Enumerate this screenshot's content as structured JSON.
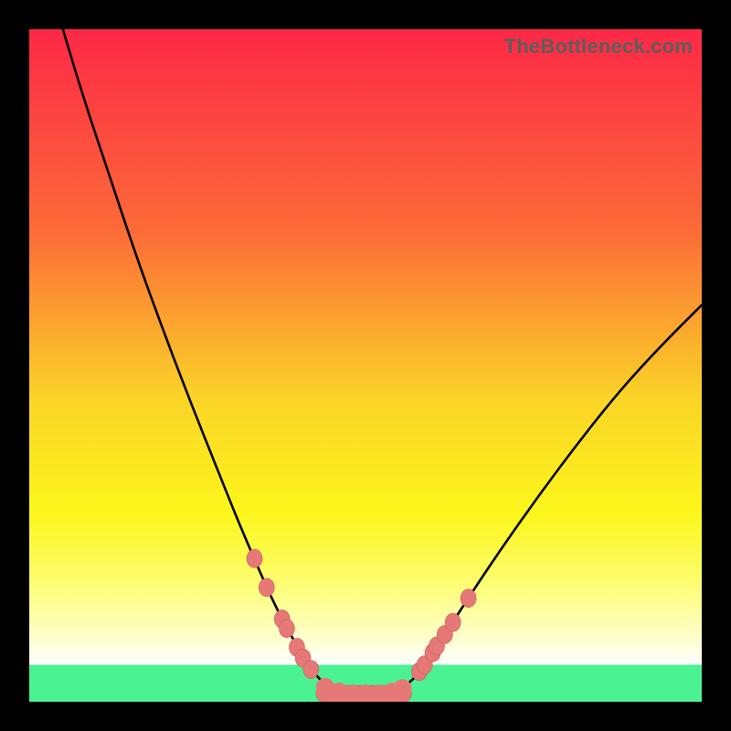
{
  "watermark": "TheBottleneck.com",
  "colors": {
    "frame": "#000000",
    "curve": "#000000",
    "marker_fill": "#e77878",
    "marker_stroke": "#c95c5c",
    "green_band": "#4af291",
    "gradient_stops": [
      {
        "offset": 0.0,
        "color": "#fd2846"
      },
      {
        "offset": 0.3,
        "color": "#fc6b38"
      },
      {
        "offset": 0.55,
        "color": "#fbd427"
      },
      {
        "offset": 0.72,
        "color": "#fcf61b"
      },
      {
        "offset": 0.82,
        "color": "#fdfd6e"
      },
      {
        "offset": 0.9,
        "color": "#feffc6"
      },
      {
        "offset": 0.945,
        "color": "#ffffff"
      }
    ]
  },
  "chart_data": {
    "type": "line",
    "title": "",
    "xlabel": "",
    "ylabel": "",
    "xlim": [
      0,
      100
    ],
    "ylim": [
      0,
      100
    ],
    "curve": {
      "x": [
        5,
        8,
        12,
        16,
        20,
        24,
        28,
        31,
        34,
        36,
        38,
        40,
        41.5,
        43,
        45,
        50,
        55,
        57,
        58.5,
        60,
        62,
        65,
        70,
        76,
        82,
        88,
        94,
        100
      ],
      "y": [
        100,
        90,
        78,
        66,
        55,
        44.5,
        34.5,
        27,
        20,
        15.5,
        11.5,
        8,
        5.5,
        3.5,
        1.8,
        1.2,
        1.8,
        3.2,
        5,
        7.3,
        10.3,
        15,
        22.5,
        31,
        39,
        46.5,
        53,
        59
      ]
    },
    "flat_band": {
      "y_from": 0,
      "y_to": 5.5
    },
    "markers_left": {
      "x": [
        33.5,
        35.3,
        37.6,
        38.3,
        39.8,
        40.7,
        41.9
      ],
      "y": [
        21.3,
        17.0,
        12.3,
        10.9,
        8.1,
        6.5,
        4.8
      ]
    },
    "markers_right": {
      "x": [
        58.0,
        58.8,
        60.0,
        60.6,
        61.8,
        63.0,
        65.3
      ],
      "y": [
        4.5,
        5.5,
        7.3,
        8.3,
        10.0,
        11.8,
        15.4
      ]
    },
    "trough_cluster": {
      "x": [
        44.0,
        46.0,
        48.0,
        50.0,
        52.0,
        54.0,
        55.5
      ],
      "y": [
        2.2,
        1.5,
        1.2,
        1.2,
        1.2,
        1.5,
        2.0
      ]
    }
  }
}
